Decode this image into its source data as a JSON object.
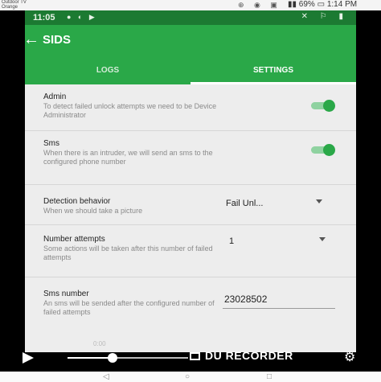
{
  "host_status": {
    "carrier": "Outdoor TV\nOrange",
    "icons": "⊕ ◉ ▣",
    "battery": "69%",
    "time": "1:14 PM"
  },
  "phone_status": {
    "time": "11:05",
    "mini_icons": "● ◐ ▶",
    "sys_icons": "✕ ⚐ ▮"
  },
  "app_bar": {
    "back_icon": "arrow-left",
    "title": "SIDS"
  },
  "tabs": [
    {
      "label": "LOGS"
    },
    {
      "label": "SETTINGS"
    }
  ],
  "settings": {
    "admin": {
      "title": "Admin",
      "summary": "To detect failed unlock attempts we need to be Device Administrator",
      "enabled": true
    },
    "sms": {
      "title": "Sms",
      "summary": "When there is an intruder, we will send an sms to the configured phone number",
      "enabled": true
    },
    "detection": {
      "title": "Detection behavior",
      "summary": "When we should take a picture",
      "value": "Fail Unl..."
    },
    "attempts": {
      "title": "Number attempts",
      "summary": "Some actions will be taken after this number of failed attempts",
      "value": "1"
    },
    "sms_number": {
      "title": "Sms number",
      "summary": "An sms will be sended after the configured number of failed attempts",
      "value": "23028502"
    }
  },
  "player": {
    "time": "0:00",
    "brand": "DU RECORDER",
    "progress": 0.37
  },
  "colors": {
    "primary": "#2aa848",
    "status_bar": "#1c7a32",
    "switch_track": "#8fd2a0"
  }
}
